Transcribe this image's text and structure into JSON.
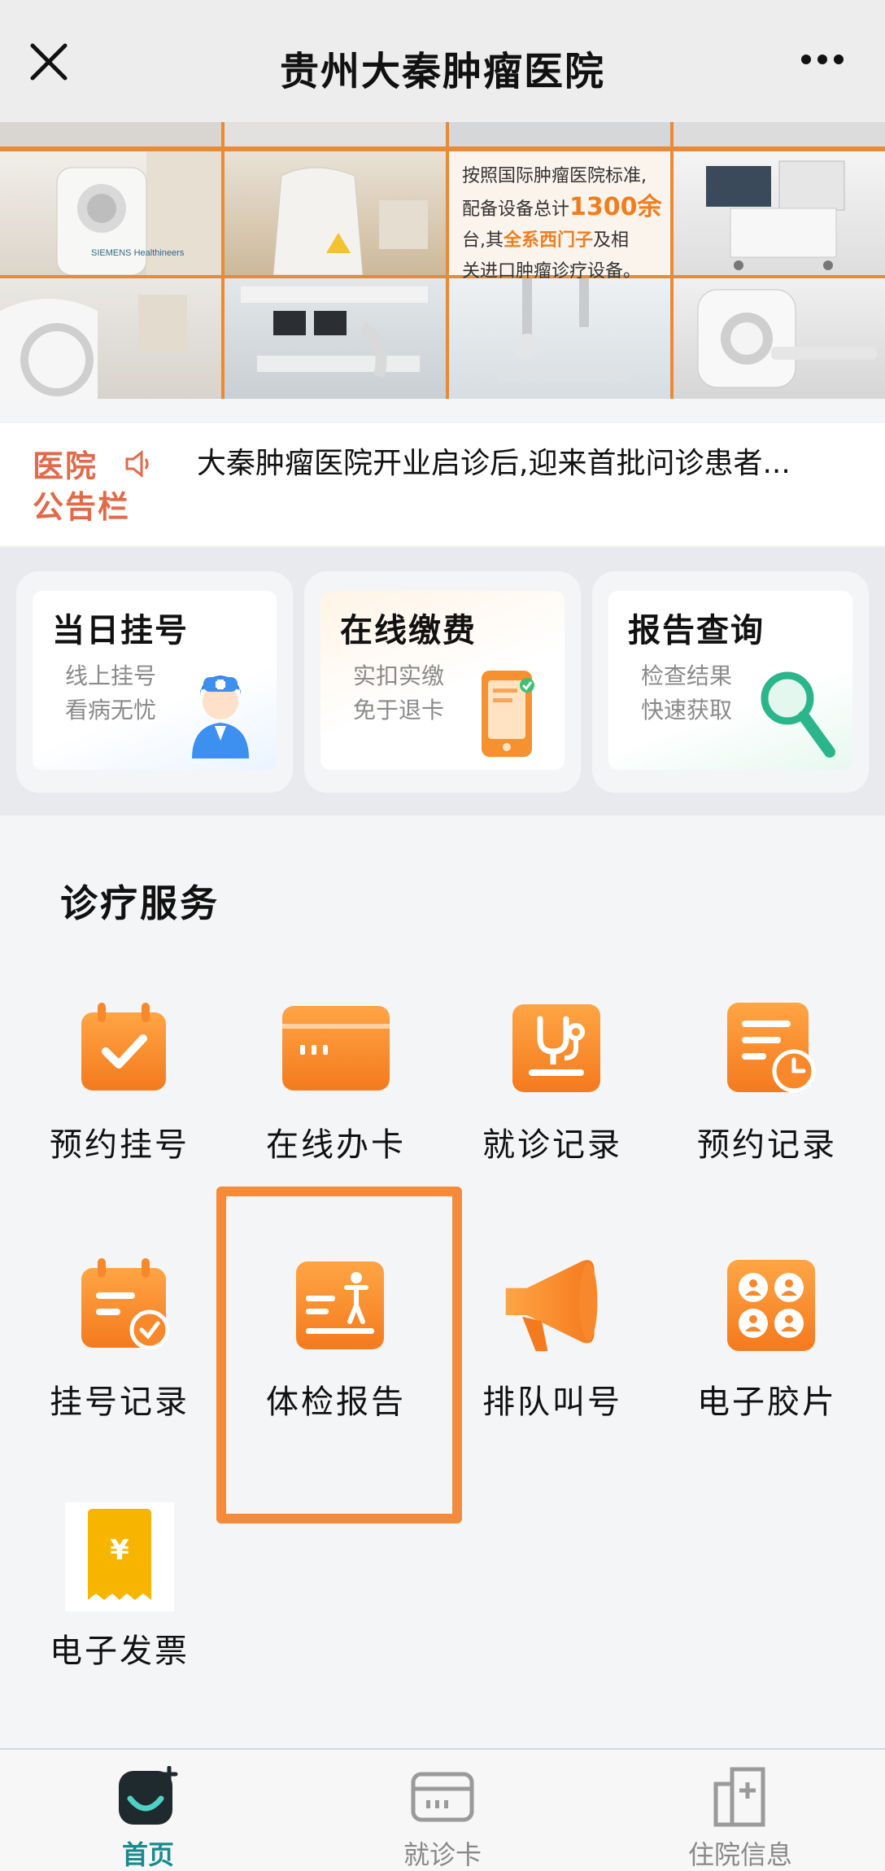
{
  "header": {
    "title": "贵州大秦肿瘤医院"
  },
  "banner": {
    "brand_logo": "SIEMENS Healthineers",
    "text_line1": "按照国际肿瘤医院标准,",
    "text_line2_pre": "配备设备总计",
    "text_line2_highlight": "1300余",
    "text_line3_pre": "台,其",
    "text_line3_highlight": "全系西门子",
    "text_line3_post": "及相",
    "text_line4": "关进口肿瘤诊疗设备。"
  },
  "notice": {
    "badge_line1": "医院",
    "badge_line2": "公告栏",
    "text": "大秦肿瘤医院开业启诊后,迎来首批问诊患者..."
  },
  "quick_cards": [
    {
      "title": "当日挂号",
      "desc": "线上挂号看病无忧",
      "icon": "doctor-icon"
    },
    {
      "title": "在线缴费",
      "desc": "实扣实缴免于退卡",
      "icon": "phone-payment-icon"
    },
    {
      "title": "报告查询",
      "desc": "检查结果快速获取",
      "icon": "magnifier-icon"
    }
  ],
  "services": {
    "title": "诊疗服务",
    "items": [
      {
        "label": "预约挂号",
        "icon": "calendar-check-icon"
      },
      {
        "label": "在线办卡",
        "icon": "card-icon"
      },
      {
        "label": "就诊记录",
        "icon": "stethoscope-icon"
      },
      {
        "label": "预约记录",
        "icon": "document-clock-icon"
      },
      {
        "label": "挂号记录",
        "icon": "calendar-list-icon"
      },
      {
        "label": "体检报告",
        "icon": "body-report-icon"
      },
      {
        "label": "排队叫号",
        "icon": "megaphone-icon"
      },
      {
        "label": "电子胶片",
        "icon": "film-grid-icon"
      },
      {
        "label": "电子发票",
        "icon": "receipt-yen-icon"
      }
    ]
  },
  "tabbar": {
    "items": [
      {
        "label": "首页",
        "active": true
      },
      {
        "label": "就诊卡",
        "active": false
      },
      {
        "label": "住院信息",
        "active": false
      }
    ]
  },
  "colors": {
    "accent_orange": "#f7892c",
    "highlight_border": "#f48a3a",
    "tab_active": "#1a8a8e"
  }
}
